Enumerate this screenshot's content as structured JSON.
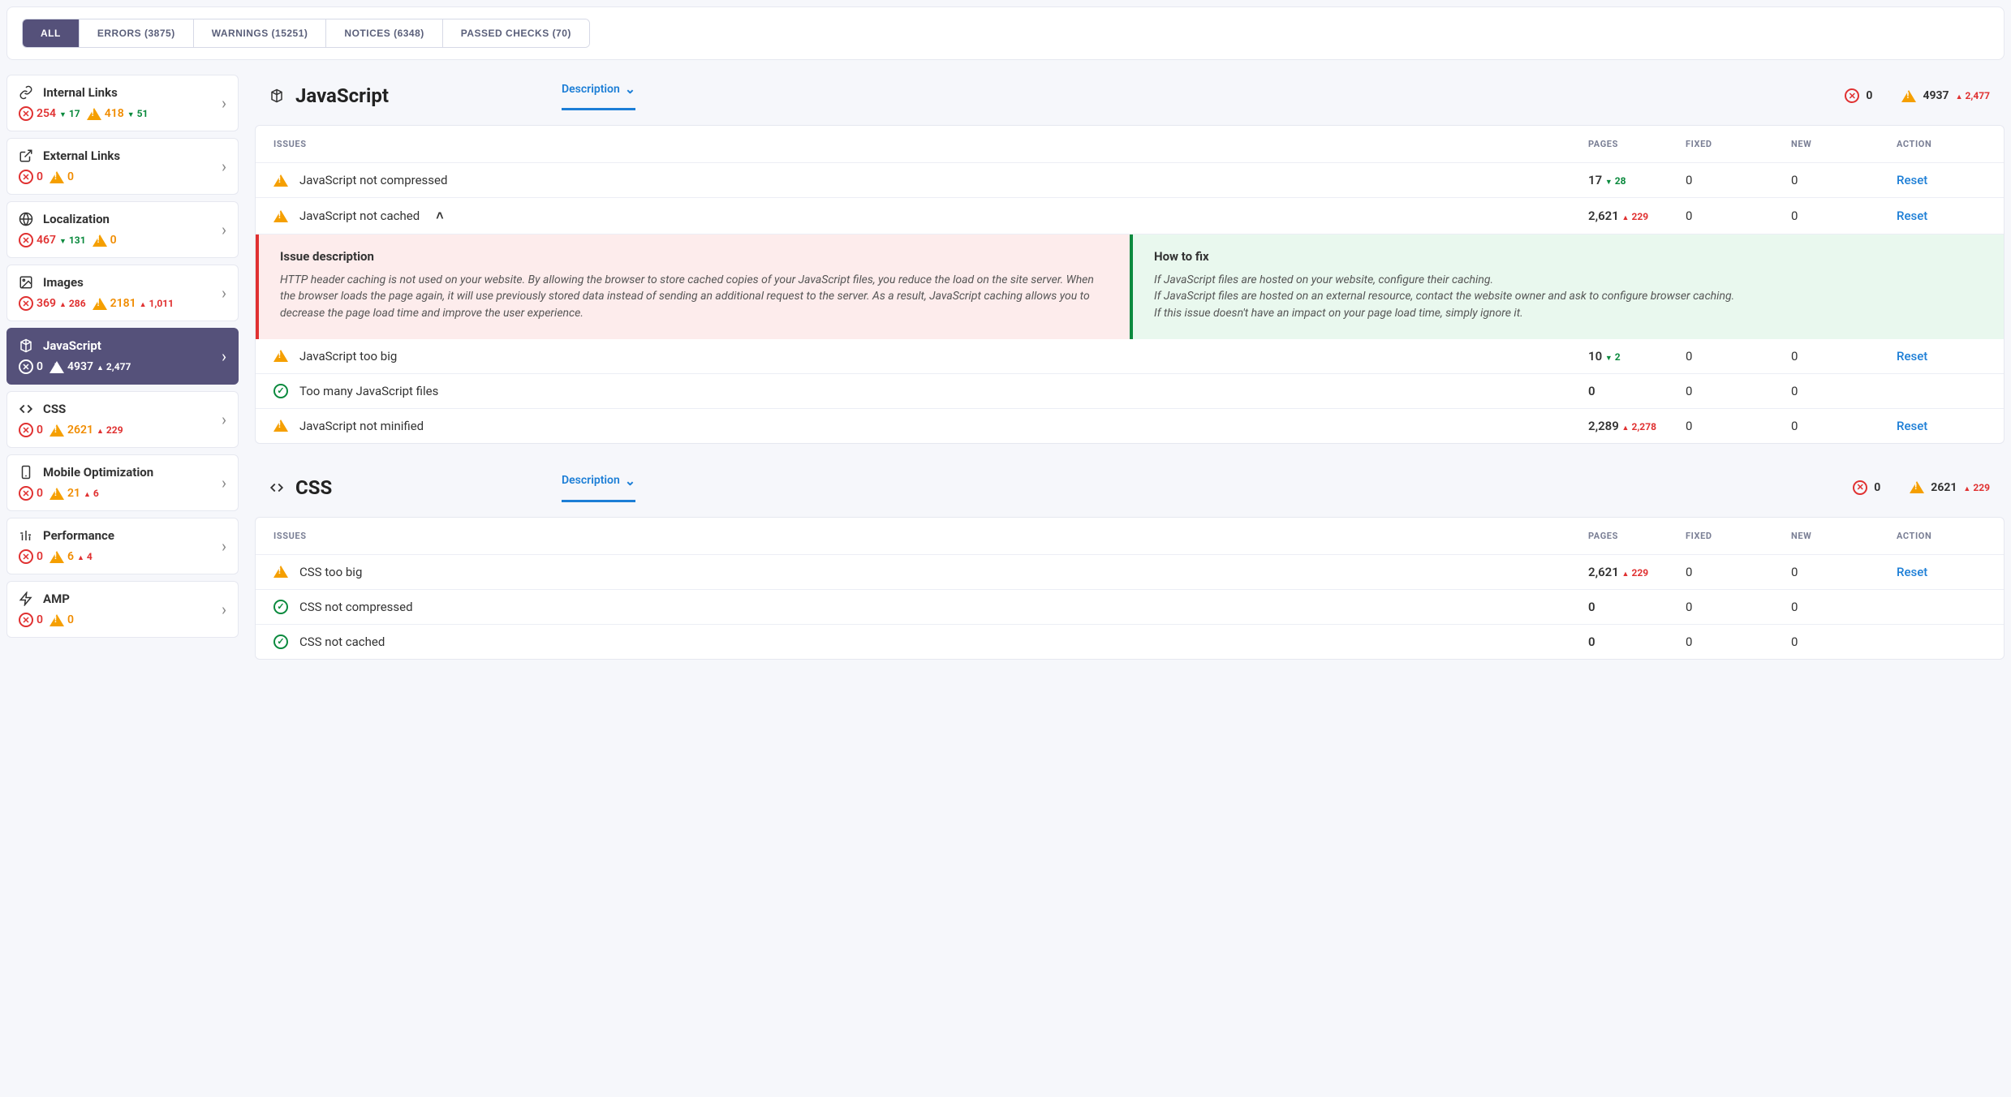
{
  "filter_tabs": [
    {
      "label": "ALL",
      "active": true
    },
    {
      "label": "ERRORS (3875)"
    },
    {
      "label": "WARNINGS (15251)"
    },
    {
      "label": "NOTICES (6348)"
    },
    {
      "label": "PASSED CHECKS (70)"
    }
  ],
  "sidebar": [
    {
      "icon": "link",
      "title": "Internal Links",
      "err": "254",
      "err_delta": "17",
      "err_dir": "down",
      "warn": "418",
      "warn_delta": "51",
      "warn_dir": "down"
    },
    {
      "icon": "ext",
      "title": "External Links",
      "err": "0",
      "warn": "0"
    },
    {
      "icon": "globe",
      "title": "Localization",
      "err": "467",
      "err_delta": "131",
      "err_dir": "down",
      "warn": "0"
    },
    {
      "icon": "image",
      "title": "Images",
      "err": "369",
      "err_delta": "286",
      "err_dir": "up",
      "warn": "2181",
      "warn_delta": "1,011",
      "warn_dir": "up"
    },
    {
      "icon": "js",
      "title": "JavaScript",
      "err": "0",
      "warn": "4937",
      "warn_delta": "2,477",
      "warn_dir": "up",
      "active": true
    },
    {
      "icon": "code",
      "title": "CSS",
      "err": "0",
      "warn": "2621",
      "warn_delta": "229",
      "warn_dir": "up"
    },
    {
      "icon": "mobile",
      "title": "Mobile Optimization",
      "err": "0",
      "warn": "21",
      "warn_delta": "6",
      "warn_dir": "up"
    },
    {
      "icon": "perf",
      "title": "Performance",
      "err": "0",
      "warn": "6",
      "warn_delta": "4",
      "warn_dir": "up"
    },
    {
      "icon": "bolt",
      "title": "AMP",
      "err": "0",
      "warn": "0"
    }
  ],
  "sections": [
    {
      "icon": "js",
      "title": "JavaScript",
      "desc_label": "Description",
      "err_total": "0",
      "warn_total": "4937",
      "warn_delta": "2,477",
      "warn_dir": "up",
      "th": {
        "issues": "ISSUES",
        "pages": "PAGES",
        "fixed": "FIXED",
        "new": "NEW",
        "action": "ACTION"
      },
      "rows": [
        {
          "type": "warn",
          "name": "JavaScript not compressed",
          "pages": "17",
          "pdelta": "28",
          "pdir": "down",
          "fixed": "0",
          "new": "0",
          "action": "Reset"
        },
        {
          "type": "warn",
          "name": "JavaScript not cached",
          "pages": "2,621",
          "pdelta": "229",
          "pdir": "up",
          "fixed": "0",
          "new": "0",
          "action": "Reset",
          "expanded": true,
          "detail": {
            "left_h": "Issue description",
            "left_body": "HTTP header caching is not used on your website. By allowing the browser to store cached copies of your JavaScript files, you reduce the load on the site server. When the browser loads the page again, it will use previously stored data instead of sending an additional request to the server. As a result, JavaScript caching allows you to decrease the page load time and improve the user experience.",
            "right_h": "How to fix",
            "right_body": "If JavaScript files are hosted on your website, configure their caching.\nIf JavaScript files are hosted on an external resource, contact the website owner and ask to configure browser caching.\nIf this issue doesn't have an impact on your page load time, simply ignore it."
          }
        },
        {
          "type": "warn",
          "name": "JavaScript too big",
          "pages": "10",
          "pdelta": "2",
          "pdir": "down",
          "fixed": "0",
          "new": "0",
          "action": "Reset"
        },
        {
          "type": "ok",
          "name": "Too many JavaScript files",
          "pages": "0",
          "fixed": "0",
          "new": "0"
        },
        {
          "type": "warn",
          "name": "JavaScript not minified",
          "pages": "2,289",
          "pdelta": "2,278",
          "pdir": "up",
          "fixed": "0",
          "new": "0",
          "action": "Reset"
        }
      ]
    },
    {
      "icon": "code",
      "title": "CSS",
      "desc_label": "Description",
      "err_total": "0",
      "warn_total": "2621",
      "warn_delta": "229",
      "warn_dir": "up",
      "th": {
        "issues": "ISSUES",
        "pages": "PAGES",
        "fixed": "FIXED",
        "new": "NEW",
        "action": "ACTION"
      },
      "rows": [
        {
          "type": "warn",
          "name": "CSS too big",
          "pages": "2,621",
          "pdelta": "229",
          "pdir": "up",
          "fixed": "0",
          "new": "0",
          "action": "Reset"
        },
        {
          "type": "ok",
          "name": "CSS not compressed",
          "pages": "0",
          "fixed": "0",
          "new": "0"
        },
        {
          "type": "ok",
          "name": "CSS not cached",
          "pages": "0",
          "fixed": "0",
          "new": "0"
        }
      ]
    }
  ]
}
